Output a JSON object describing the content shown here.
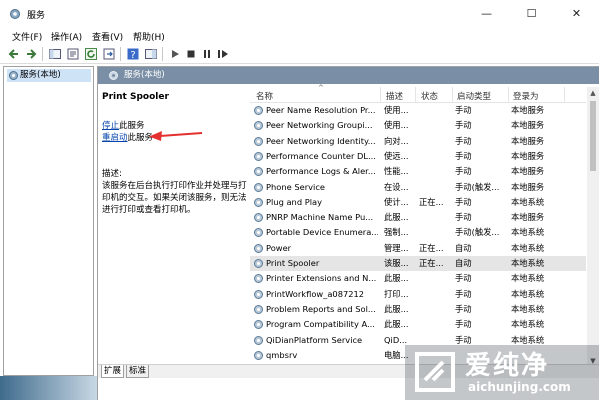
{
  "window": {
    "title": "服务",
    "controls": {
      "minimize": "—",
      "maximize": "☐",
      "close": "✕"
    }
  },
  "menu": [
    "文件(F)",
    "操作(A)",
    "查看(V)",
    "帮助(H)"
  ],
  "left_pane": {
    "item": "服务(本地)"
  },
  "right_pane": {
    "header": "服务(本地)",
    "selected_service": "Print Spooler",
    "stop_link": "停止",
    "stop_suffix": "此服务",
    "restart_link": "重启动",
    "restart_suffix": "此服务",
    "desc_label": "描述:",
    "desc_text": "该服务在后台执行打印作业并处理与打印机的交互。如果关闭该服务，则无法进行打印或查看打印机。"
  },
  "grid": {
    "headers": {
      "name": "名称",
      "desc": "描述",
      "state": "状态",
      "start": "启动类型",
      "login": "登录为"
    },
    "rows": [
      {
        "name": "Peer Name Resolution Pr...",
        "desc": "使用...",
        "state": "",
        "start": "手动",
        "login": "本地服务"
      },
      {
        "name": "Peer Networking Groupi...",
        "desc": "使用...",
        "state": "",
        "start": "手动",
        "login": "本地服务"
      },
      {
        "name": "Peer Networking Identity...",
        "desc": "向对...",
        "state": "",
        "start": "手动",
        "login": "本地服务"
      },
      {
        "name": "Performance Counter DL...",
        "desc": "使远...",
        "state": "",
        "start": "手动",
        "login": "本地服务"
      },
      {
        "name": "Performance Logs & Aler...",
        "desc": "性能...",
        "state": "",
        "start": "手动",
        "login": "本地服务"
      },
      {
        "name": "Phone Service",
        "desc": "在设...",
        "state": "",
        "start": "手动(触发...",
        "login": "本地服务"
      },
      {
        "name": "Plug and Play",
        "desc": "使计...",
        "state": "正在...",
        "start": "手动",
        "login": "本地系统"
      },
      {
        "name": "PNRP Machine Name Pu...",
        "desc": "此服...",
        "state": "",
        "start": "手动",
        "login": "本地服务"
      },
      {
        "name": "Portable Device Enumera...",
        "desc": "强制...",
        "state": "",
        "start": "手动(触发...",
        "login": "本地系统"
      },
      {
        "name": "Power",
        "desc": "管理...",
        "state": "正在...",
        "start": "自动",
        "login": "本地系统"
      },
      {
        "name": "Print Spooler",
        "desc": "该服...",
        "state": "正在...",
        "start": "自动",
        "login": "本地系统"
      },
      {
        "name": "Printer Extensions and N...",
        "desc": "此服...",
        "state": "",
        "start": "手动",
        "login": "本地系统"
      },
      {
        "name": "PrintWorkflow_a087212",
        "desc": "打印...",
        "state": "",
        "start": "手动",
        "login": "本地系统"
      },
      {
        "name": "Problem Reports and Sol...",
        "desc": "此服...",
        "state": "",
        "start": "手动",
        "login": "本地系统"
      },
      {
        "name": "Program Compatibility A...",
        "desc": "此服...",
        "state": "",
        "start": "手动",
        "login": "本地系统"
      },
      {
        "name": "QiDianPlatform Service",
        "desc": "QiD...",
        "state": "",
        "start": "手动",
        "login": "本地系统"
      },
      {
        "name": "qmbsrv",
        "desc": "电脑...",
        "state": "",
        "start": "",
        "login": ""
      }
    ],
    "selected_index": 10
  },
  "tabs": [
    "扩展",
    "标准"
  ],
  "watermark": {
    "big": "爱纯净",
    "small": "aichunjing.com"
  },
  "colors": {
    "link": "#0645ad",
    "header_bg": "#7a8fa6",
    "selection": "#e5e5e5",
    "arrow": "#e53030"
  }
}
